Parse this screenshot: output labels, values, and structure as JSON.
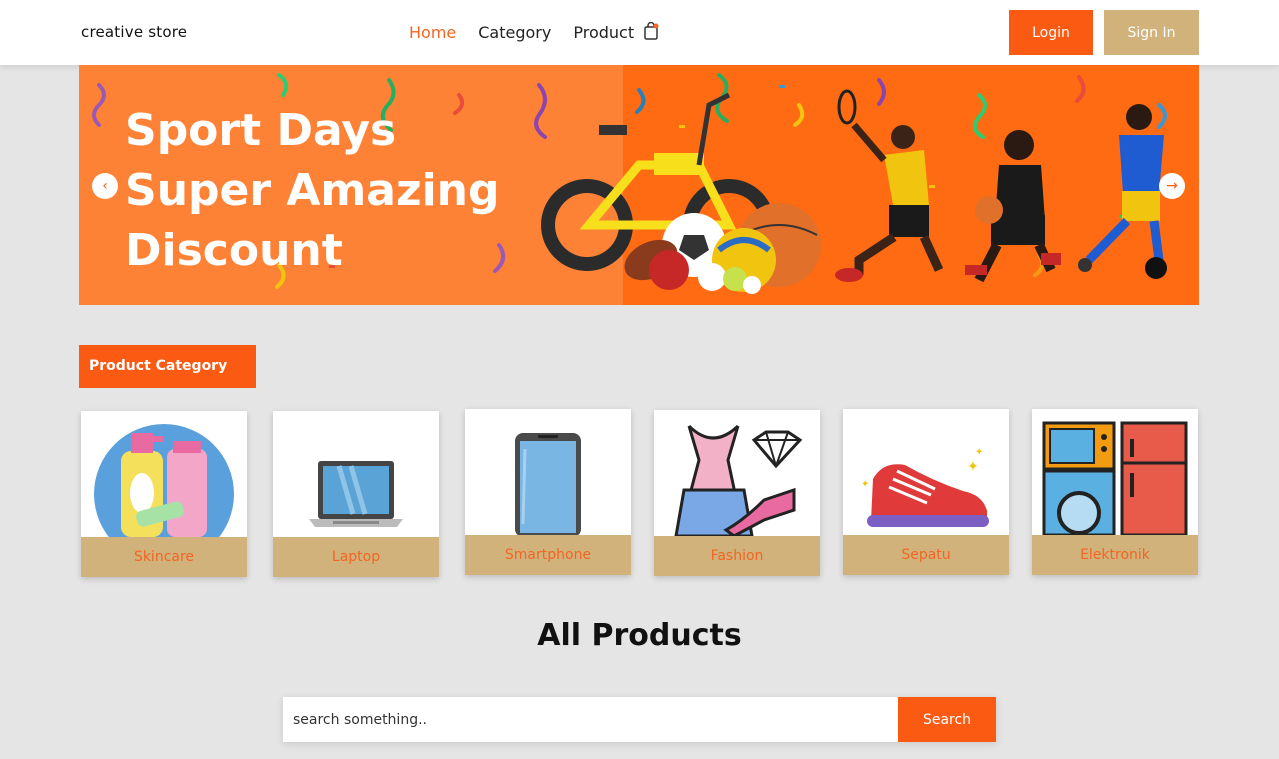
{
  "navbar": {
    "brand": "creative store",
    "links": [
      {
        "label": "Home",
        "active": true
      },
      {
        "label": "Category",
        "active": false
      },
      {
        "label": "Product",
        "active": false
      }
    ],
    "login_label": "Login",
    "signin_label": "Sign In",
    "cart_icon": "shopping-bag-icon"
  },
  "banner": {
    "title_lines": [
      "Sport Days",
      "Super Amazing",
      "Discount"
    ],
    "prev_icon": "chevron-left-icon",
    "next_icon": "arrow-right-icon"
  },
  "categories": {
    "title": "Product Category",
    "items": [
      {
        "label": "Skincare",
        "icon": "skincare-icon"
      },
      {
        "label": "Laptop",
        "icon": "laptop-icon"
      },
      {
        "label": "Smartphone",
        "icon": "smartphone-icon"
      },
      {
        "label": "Fashion",
        "icon": "fashion-icon"
      },
      {
        "label": "Sepatu",
        "icon": "shoe-icon"
      },
      {
        "label": "Elektronik",
        "icon": "appliance-icon"
      }
    ]
  },
  "products": {
    "title": "All Products",
    "search_placeholder": "search something..",
    "search_button": "Search"
  },
  "colors": {
    "accent": "#fb5a13",
    "tan": "#d1b27b",
    "background": "#e5e5e5"
  }
}
